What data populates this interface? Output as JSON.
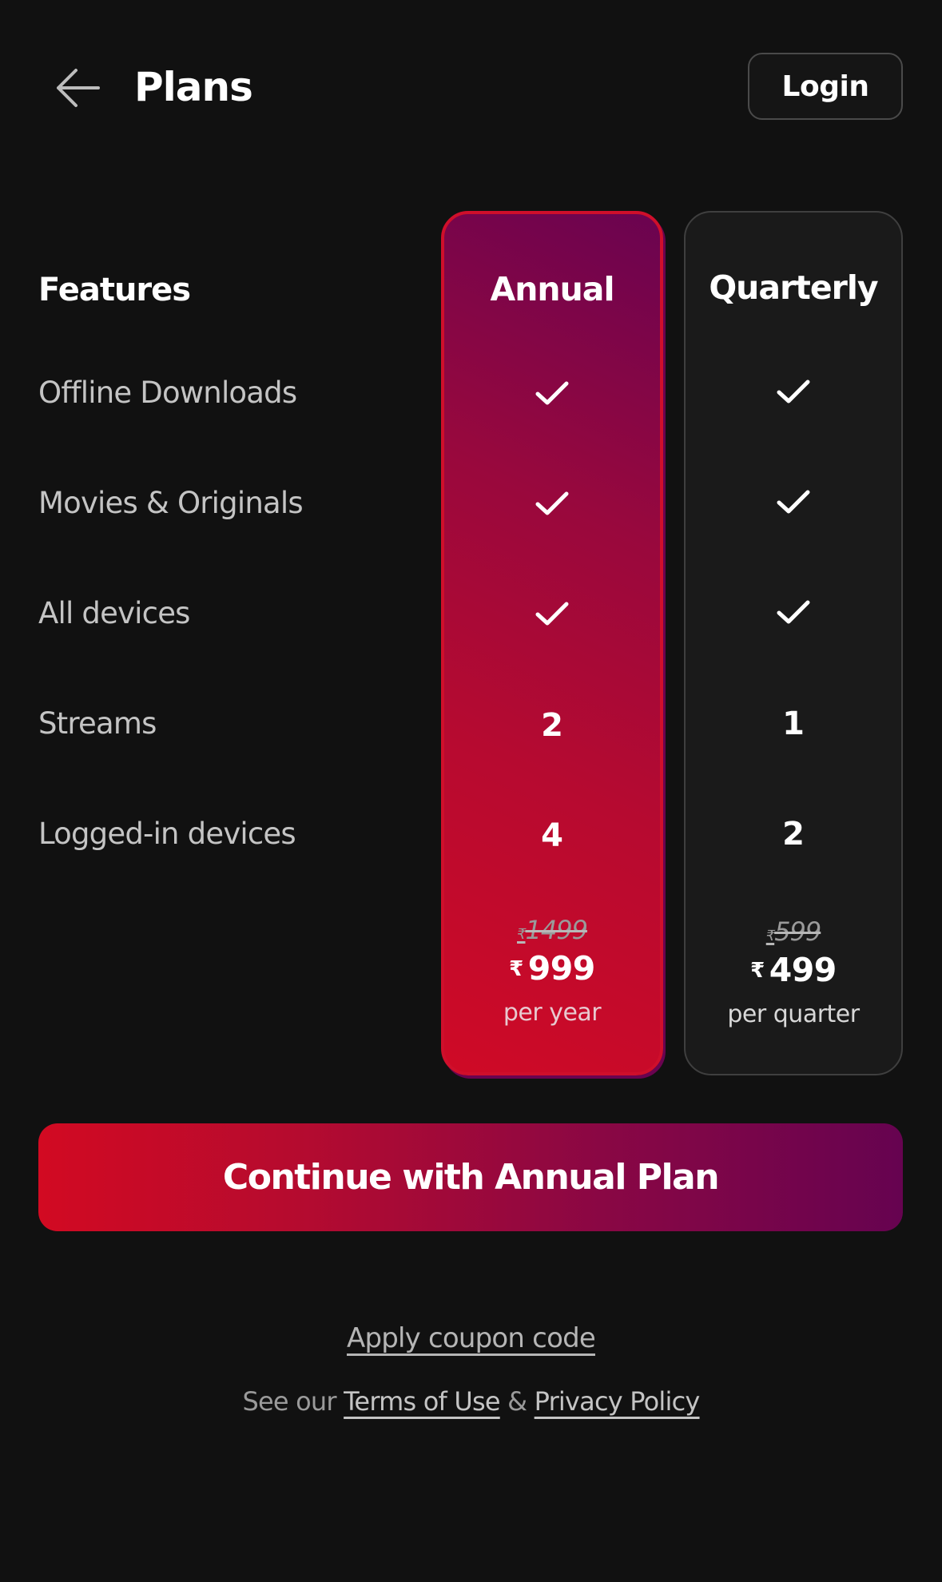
{
  "header": {
    "title": "Plans",
    "login_label": "Login"
  },
  "features": {
    "heading": "Features",
    "items": [
      {
        "label": "Offline Downloads"
      },
      {
        "label": "Movies & Originals"
      },
      {
        "label": "All devices"
      },
      {
        "label": "Streams"
      },
      {
        "label": "Logged-in devices"
      }
    ]
  },
  "plans": {
    "annual": {
      "name": "Annual",
      "offline_downloads": "check",
      "movies_originals": "check",
      "all_devices": "check",
      "streams": "2",
      "logged_in_devices": "4",
      "currency": "₹",
      "old_price": "1499",
      "price": "999",
      "period": "per year",
      "selected": true
    },
    "quarterly": {
      "name": "Quarterly",
      "offline_downloads": "check",
      "movies_originals": "check",
      "all_devices": "check",
      "streams": "1",
      "logged_in_devices": "2",
      "currency": "₹",
      "old_price": "599",
      "price": "499",
      "period": "per quarter",
      "selected": false
    }
  },
  "cta": {
    "label": "Continue with Annual Plan"
  },
  "footer": {
    "coupon_label": "Apply coupon code",
    "legal_prefix": "See our",
    "terms_label": "Terms of Use",
    "ampersand": "&",
    "privacy_label": "Privacy Policy"
  },
  "colors": {
    "background": "#111111",
    "accent_start": "#d20a22",
    "accent_end": "#660350",
    "card_dark": "#1a1a1a"
  }
}
